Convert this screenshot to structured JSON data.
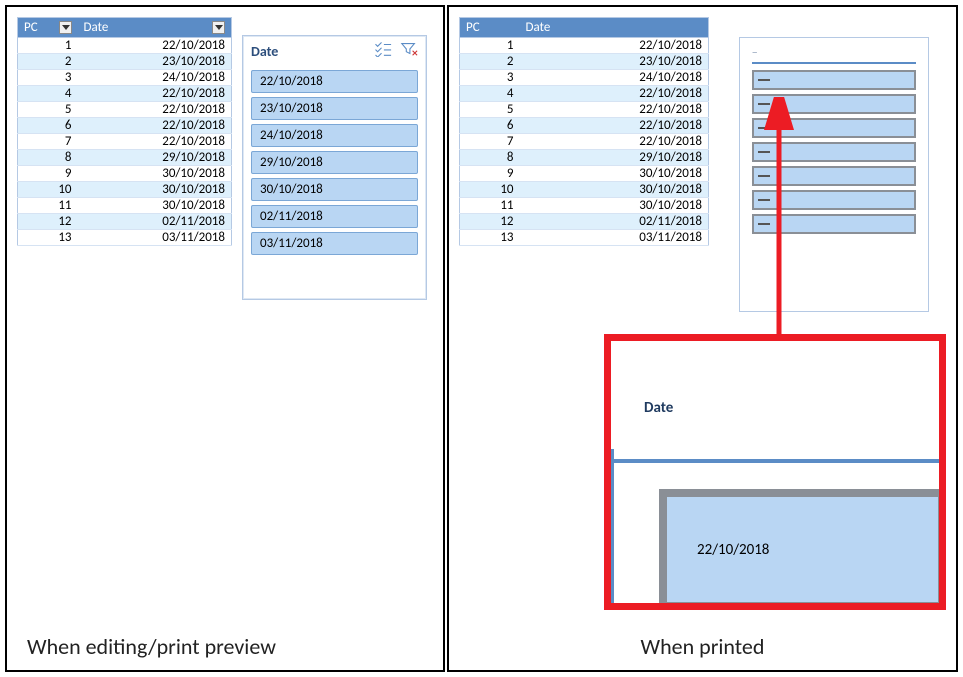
{
  "captions": {
    "editing": "When editing/print preview",
    "printed": "When printed"
  },
  "table": {
    "headers": {
      "pc": "PC",
      "date": "Date"
    },
    "rows": [
      {
        "pc": "1",
        "date": "22/10/2018"
      },
      {
        "pc": "2",
        "date": "23/10/2018"
      },
      {
        "pc": "3",
        "date": "24/10/2018"
      },
      {
        "pc": "4",
        "date": "22/10/2018"
      },
      {
        "pc": "5",
        "date": "22/10/2018"
      },
      {
        "pc": "6",
        "date": "22/10/2018"
      },
      {
        "pc": "7",
        "date": "22/10/2018"
      },
      {
        "pc": "8",
        "date": "29/10/2018"
      },
      {
        "pc": "9",
        "date": "30/10/2018"
      },
      {
        "pc": "10",
        "date": "30/10/2018"
      },
      {
        "pc": "11",
        "date": "30/10/2018"
      },
      {
        "pc": "12",
        "date": "02/11/2018"
      },
      {
        "pc": "13",
        "date": "03/11/2018"
      }
    ]
  },
  "slicer": {
    "title": "Date",
    "items": [
      "22/10/2018",
      "23/10/2018",
      "24/10/2018",
      "29/10/2018",
      "30/10/2018",
      "02/11/2018",
      "03/11/2018"
    ]
  },
  "zoom": {
    "title": "Date",
    "first_item": "22/10/2018"
  },
  "print_slicer_rows": 7
}
